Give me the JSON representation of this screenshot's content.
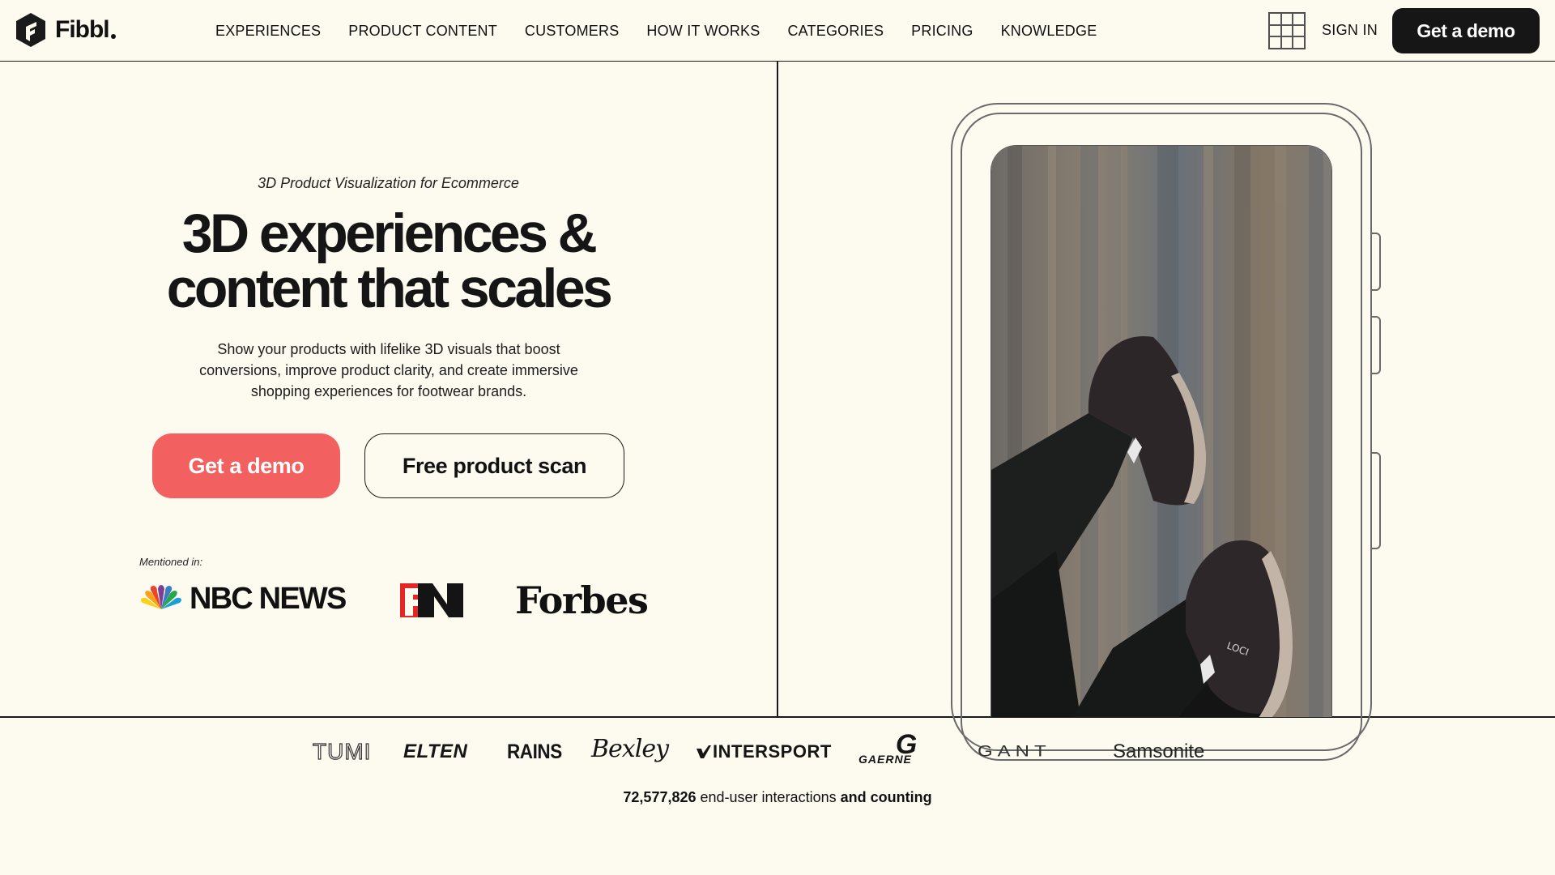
{
  "brand": {
    "name": "Fibbl"
  },
  "nav": {
    "items": [
      "EXPERIENCES",
      "PRODUCT CONTENT",
      "CUSTOMERS",
      "HOW IT WORKS",
      "CATEGORIES",
      "PRICING",
      "KNOWLEDGE"
    ],
    "sign_in": "SIGN IN",
    "demo_button": "Get a demo"
  },
  "hero": {
    "eyebrow": "3D Product Visualization for Ecommerce",
    "headline_line1": "3D experiences &",
    "headline_line2": "content that scales",
    "subcopy": "Show your products with lifelike 3D visuals that boost conversions, improve product clarity, and create immersive shopping experiences for footwear brands.",
    "primary_cta": "Get a demo",
    "secondary_cta": "Free product scan"
  },
  "press": {
    "label": "Mentioned in:",
    "logos": [
      "NBC NEWS",
      "FN",
      "Forbes"
    ]
  },
  "phone": {
    "shoe_brand_text": "LOCI"
  },
  "customers": {
    "logos": [
      "TUMI",
      "ELTEN",
      "RAINS",
      "Bexley",
      "INTERSPORT",
      "GAERNE",
      "G",
      "GANT",
      "Samsonite"
    ]
  },
  "stats": {
    "count": "72,577,826",
    "middle": " end-user interactions ",
    "tail": "and counting"
  },
  "colors": {
    "background": "#fdfaf0",
    "accent": "#f2615f",
    "dark": "#161616"
  }
}
